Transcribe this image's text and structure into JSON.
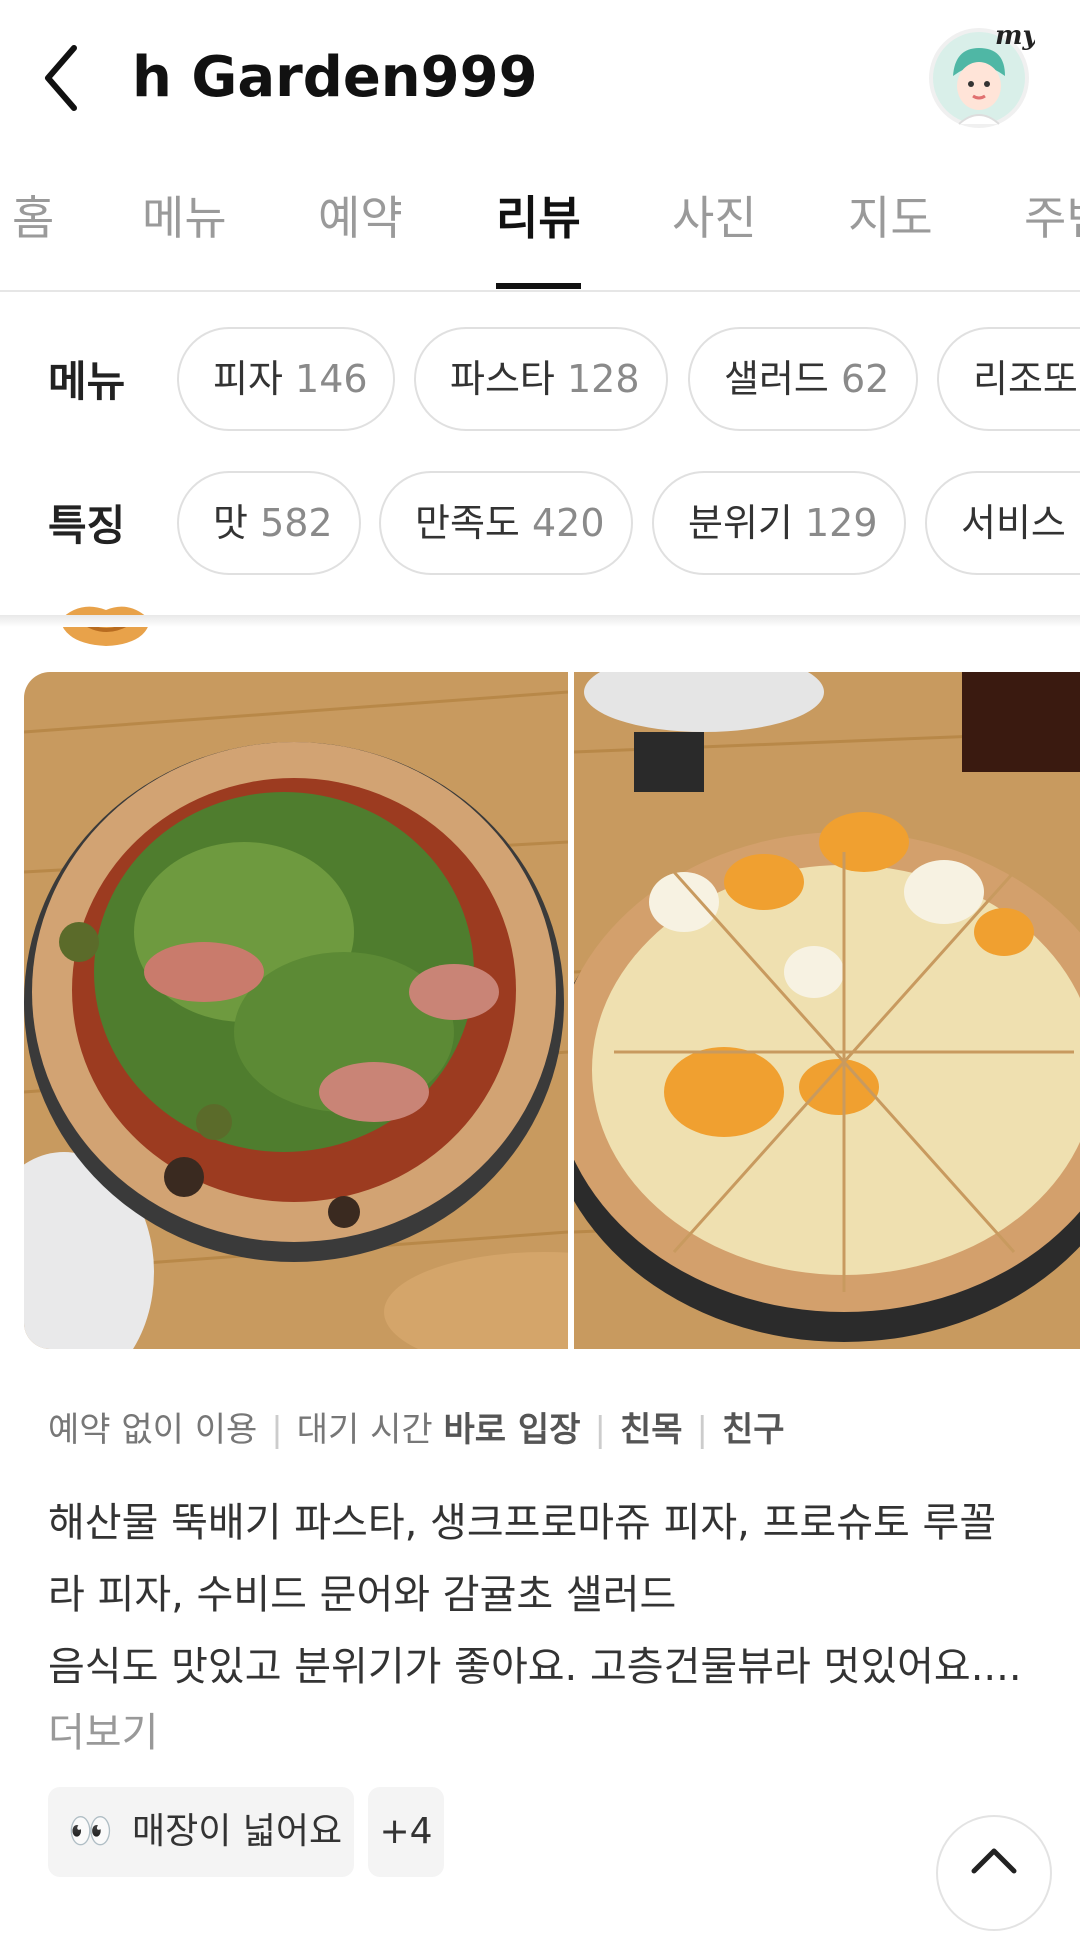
{
  "header": {
    "title": "h Garden999",
    "back_icon": "chevron-left-icon",
    "avatar_badge": "my"
  },
  "tabs": [
    {
      "label": "홈",
      "active": false
    },
    {
      "label": "메뉴",
      "active": false
    },
    {
      "label": "예약",
      "active": false
    },
    {
      "label": "리뷰",
      "active": true
    },
    {
      "label": "사진",
      "active": false
    },
    {
      "label": "지도",
      "active": false
    },
    {
      "label": "주변",
      "active": false
    }
  ],
  "filters": {
    "menu": {
      "label": "메뉴",
      "chips": [
        {
          "name": "피자",
          "count": "146"
        },
        {
          "name": "파스타",
          "count": "128"
        },
        {
          "name": "샐러드",
          "count": "62"
        },
        {
          "name": "리조또",
          "count": ""
        }
      ]
    },
    "feature": {
      "label": "특징",
      "chips": [
        {
          "name": "맛",
          "count": "582"
        },
        {
          "name": "만족도",
          "count": "420"
        },
        {
          "name": "분위기",
          "count": "129"
        },
        {
          "name": "서비스",
          "count": ""
        }
      ]
    }
  },
  "review": {
    "visit_info": {
      "reservation": "예약 없이 이용",
      "wait_label": "대기 시간",
      "wait_value": "바로 입장",
      "purpose": "친목",
      "companion": "친구"
    },
    "text_lines": [
      "해산물 뚝배기 파스타, 생크프로마쥬 피자, 프로슈토 루꼴",
      "라 피자, 수비드 문어와 감귤초 샐러드",
      "음식도 맛있고 분위기가 좋아요. 고층건물뷰라 멋있어요...."
    ],
    "more_label": "더보기",
    "keyword_tag": "매장이 넓어요",
    "keyword_emoji": "👀",
    "more_tags": "+4"
  },
  "colors": {
    "active_tab": "#111111",
    "inactive_tab": "#9a9a9a",
    "chip_border": "#e0e0e0"
  }
}
